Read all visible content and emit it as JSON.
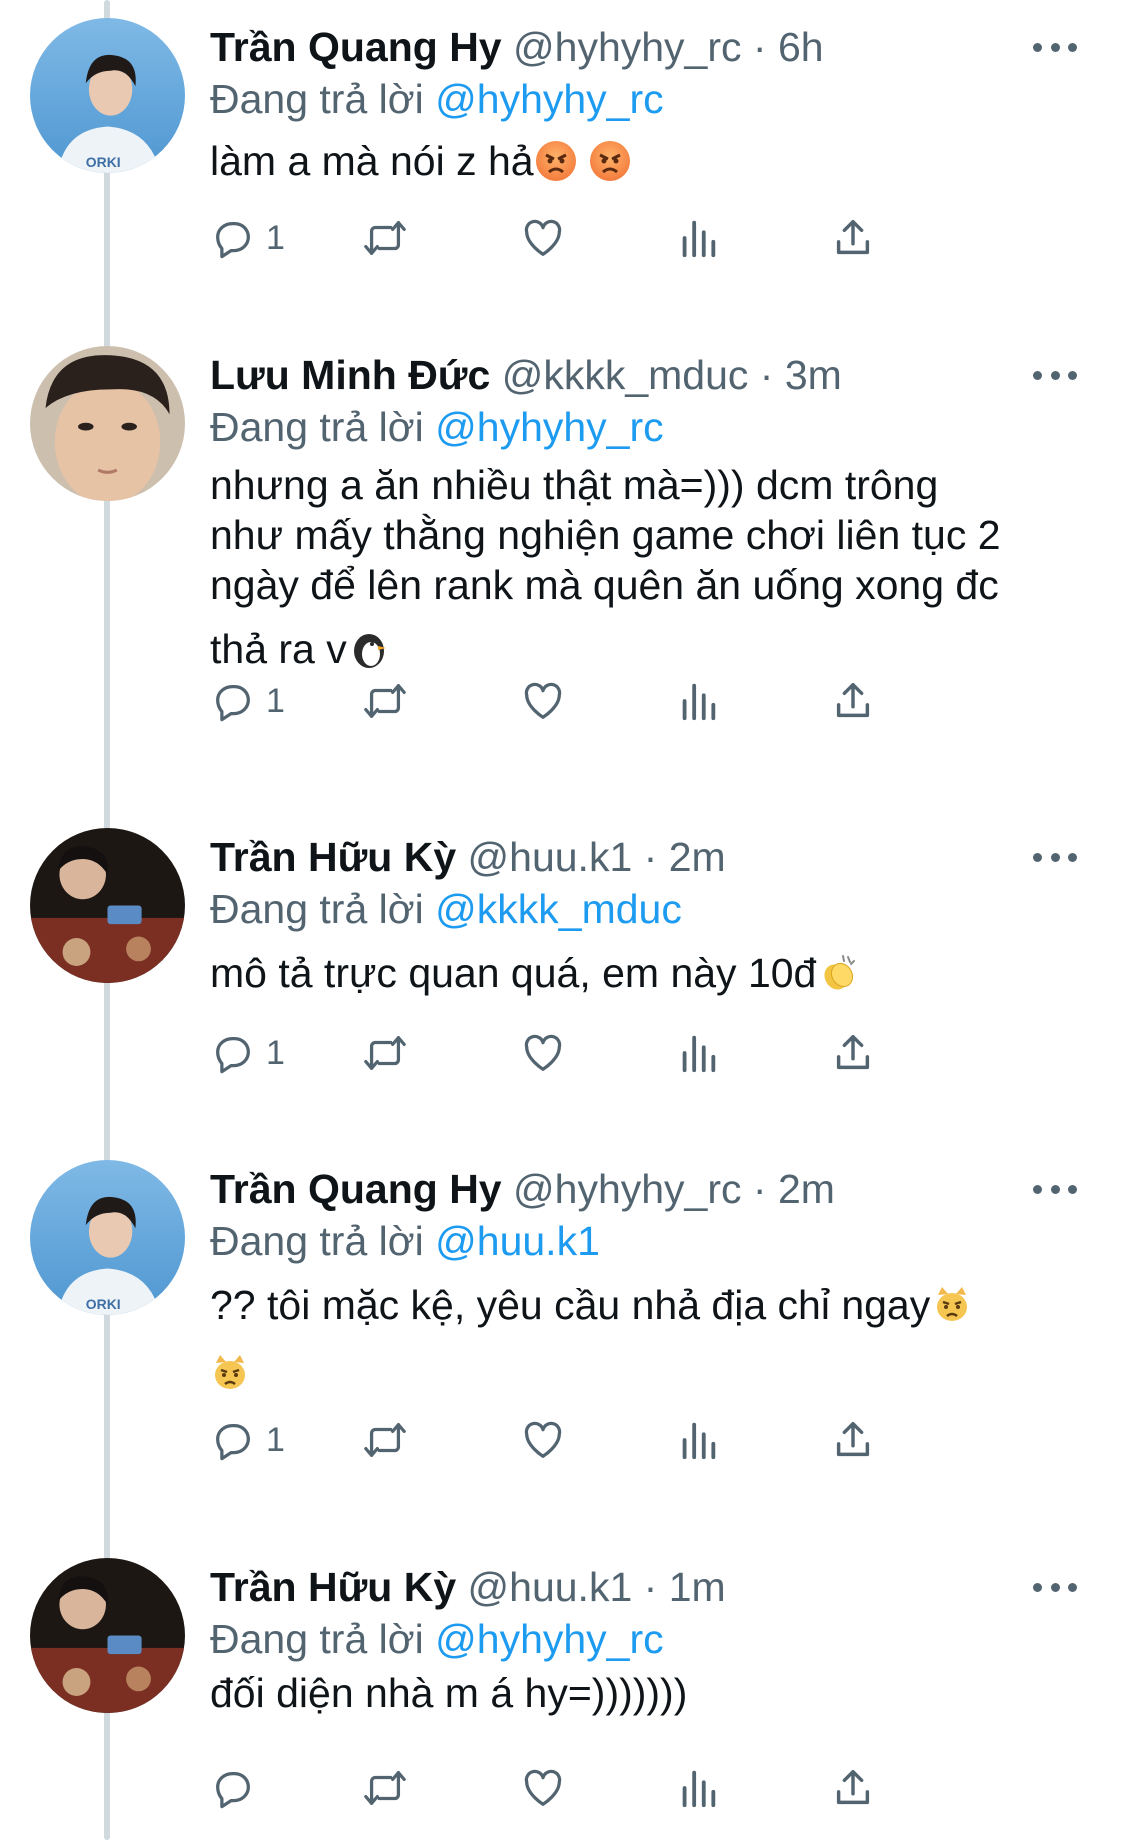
{
  "tweets": [
    {
      "name": "Trần Quang Hy",
      "handle": "@hyhyhy_rc",
      "separator": "·",
      "time": "6h",
      "reply_prefix": "Đang trả lời",
      "reply_mention": "@hyhyhy_rc",
      "lines": [
        "làm a mà nói z hả"
      ],
      "emojis": [
        "angry-face",
        "angry-face"
      ],
      "reply_count": "1",
      "avatar": "avatar-blue-shirt"
    },
    {
      "name": "Lưu Minh Đức",
      "handle": "@kkkk_mduc",
      "separator": "·",
      "time": "3m",
      "reply_prefix": "Đang trả lời",
      "reply_mention": "@hyhyhy_rc",
      "lines": [
        "nhưng a ăn nhiều thật mà=))) dcm trông",
        "như mấy thằng nghiện game chơi liên tục 2",
        "ngày để lên rank mà quên ăn uống xong đc",
        "thả ra v"
      ],
      "emojis": [
        "penguin"
      ],
      "reply_count": "1",
      "avatar": "avatar-selfie"
    },
    {
      "name": "Trần Hữu Kỳ",
      "handle": "@huu.k1",
      "separator": "·",
      "time": "2m",
      "reply_prefix": "Đang trả lời",
      "reply_mention": "@kkkk_mduc",
      "lines": [
        "mô tả trực quan quá, em này 10đ"
      ],
      "emojis": [
        "clapping-hands"
      ],
      "reply_count": "1",
      "avatar": "avatar-dark-restaurant"
    },
    {
      "name": "Trần Quang Hy",
      "handle": "@hyhyhy_rc",
      "separator": "·",
      "time": "2m",
      "reply_prefix": "Đang trả lời",
      "reply_mention": "@huu.k1",
      "lines": [
        "?? tôi mặc kệ, yêu cầu nhả địa chỉ ngay",
        ""
      ],
      "emojis": [
        "pouting-cat",
        "pouting-cat"
      ],
      "reply_count": "1",
      "avatar": "avatar-blue-shirt"
    },
    {
      "name": "Trần Hữu Kỳ",
      "handle": "@huu.k1",
      "separator": "·",
      "time": "1m",
      "reply_prefix": "Đang trả lời",
      "reply_mention": "@hyhyhy_rc",
      "lines": [
        "đối diện nhà m á hy=)))))))"
      ],
      "emojis": [],
      "reply_count": "",
      "avatar": "avatar-dark-restaurant"
    }
  ],
  "icons": {
    "reply": "reply-icon",
    "retweet": "retweet-icon",
    "like": "heart-icon",
    "views": "views-icon",
    "share": "share-icon",
    "more": "more-icon"
  },
  "colors": {
    "accent": "#1d9bf0",
    "secondary_text": "#536471",
    "thread_line": "#cfd9de"
  }
}
